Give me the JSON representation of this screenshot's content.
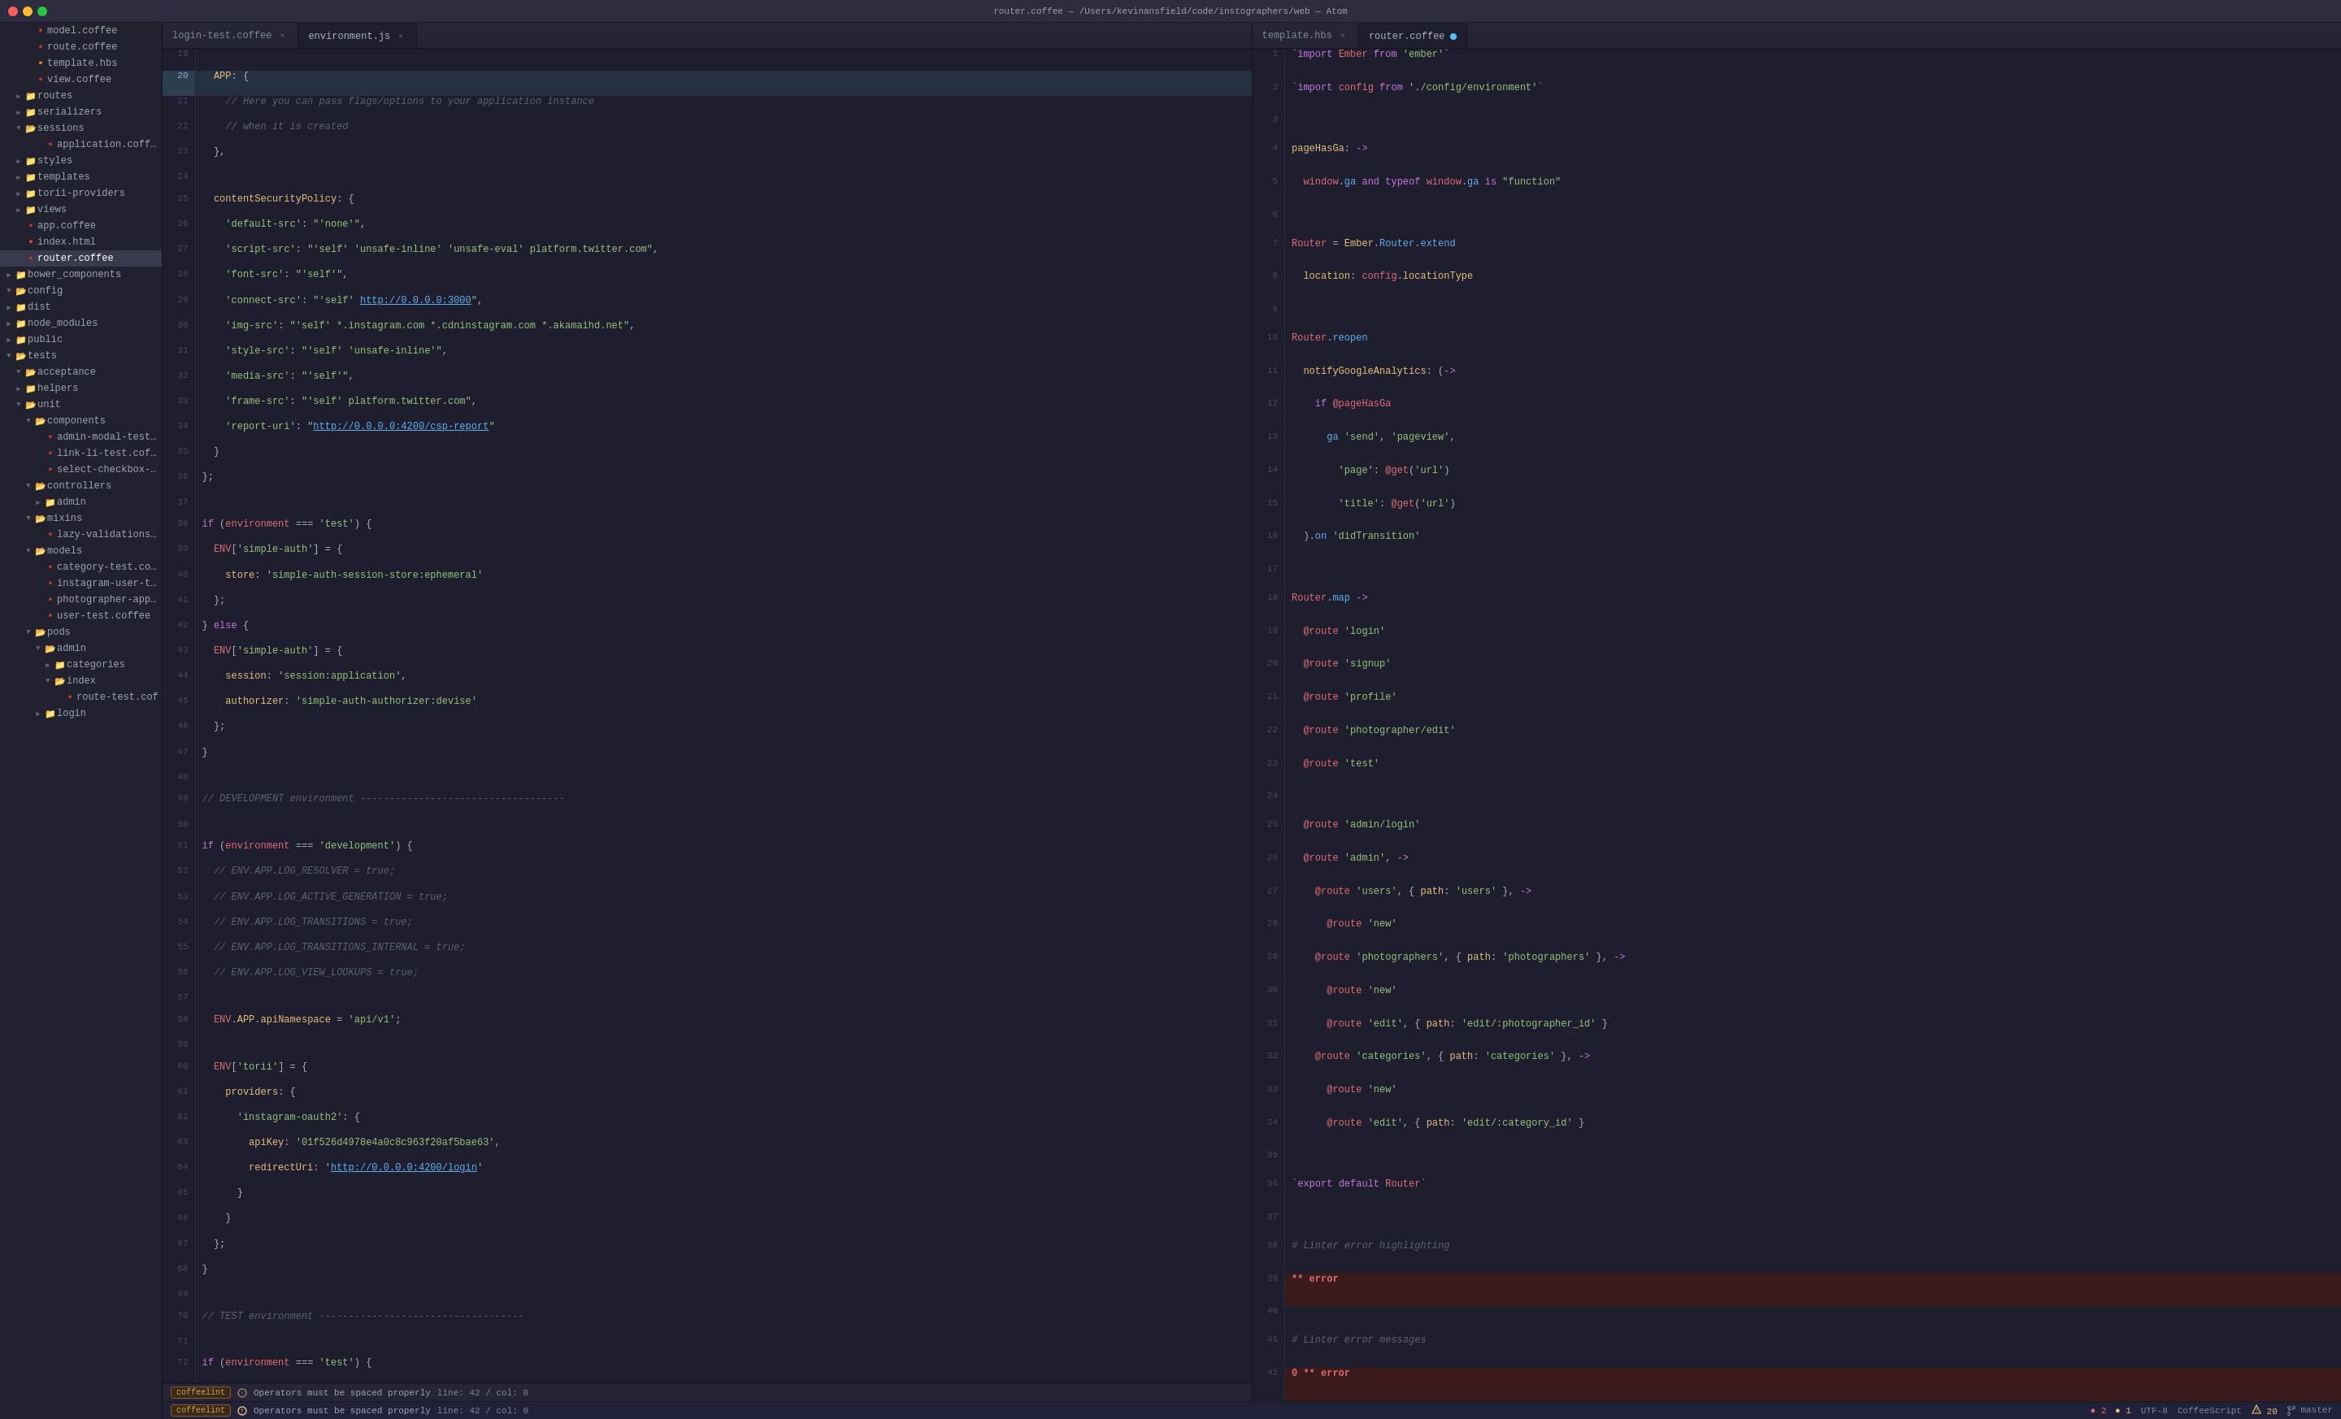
{
  "titlebar": {
    "title": "router.coffee — /Users/kevinansfield/code/instographers/web — Atom"
  },
  "sidebar": {
    "items": [
      {
        "id": "model-coffee",
        "label": "model.coffee",
        "type": "file-coffee",
        "indent": 2
      },
      {
        "id": "route-coffee",
        "label": "route.coffee",
        "type": "file-coffee",
        "indent": 2
      },
      {
        "id": "template-hbs",
        "label": "template.hbs",
        "type": "file-hbs",
        "indent": 2
      },
      {
        "id": "view-coffee",
        "label": "view.coffee",
        "type": "file-coffee",
        "indent": 2
      },
      {
        "id": "routes-folder",
        "label": "routes",
        "type": "folder",
        "indent": 1,
        "open": false
      },
      {
        "id": "serializers-folder",
        "label": "serializers",
        "type": "folder",
        "indent": 1,
        "open": false
      },
      {
        "id": "sessions-folder",
        "label": "sessions",
        "type": "folder",
        "indent": 1,
        "open": true
      },
      {
        "id": "application-coffee",
        "label": "application.coffee",
        "type": "file-coffee",
        "indent": 3
      },
      {
        "id": "styles-folder",
        "label": "styles",
        "type": "folder",
        "indent": 1,
        "open": false
      },
      {
        "id": "templates-folder",
        "label": "templates",
        "type": "folder",
        "indent": 1,
        "open": false
      },
      {
        "id": "torii-providers-folder",
        "label": "torii-providers",
        "type": "folder",
        "indent": 1,
        "open": false
      },
      {
        "id": "views-folder",
        "label": "views",
        "type": "folder",
        "indent": 1,
        "open": false
      },
      {
        "id": "app-coffee",
        "label": "app.coffee",
        "type": "file-coffee",
        "indent": 1
      },
      {
        "id": "index-html",
        "label": "index.html",
        "type": "file-html",
        "indent": 1
      },
      {
        "id": "router-coffee",
        "label": "router.coffee",
        "type": "file-coffee",
        "indent": 1,
        "active": true
      },
      {
        "id": "bower-components",
        "label": "bower_components",
        "type": "folder",
        "indent": 0,
        "open": false
      },
      {
        "id": "config-folder",
        "label": "config",
        "type": "folder",
        "indent": 0,
        "open": true
      },
      {
        "id": "dist-folder",
        "label": "dist",
        "type": "folder",
        "indent": 0,
        "open": false
      },
      {
        "id": "node-modules",
        "label": "node_modules",
        "type": "folder",
        "indent": 0,
        "open": false
      },
      {
        "id": "public-folder",
        "label": "public",
        "type": "folder",
        "indent": 0,
        "open": false
      },
      {
        "id": "tests-folder",
        "label": "tests",
        "type": "folder-yellow",
        "indent": 0,
        "open": true
      },
      {
        "id": "acceptance-folder",
        "label": "acceptance",
        "type": "folder-yellow",
        "indent": 1,
        "open": true
      },
      {
        "id": "helpers-folder",
        "label": "helpers",
        "type": "folder",
        "indent": 1,
        "open": false
      },
      {
        "id": "unit-folder",
        "label": "unit",
        "type": "folder",
        "indent": 1,
        "open": true
      },
      {
        "id": "components-folder",
        "label": "components",
        "type": "folder",
        "indent": 2,
        "open": true
      },
      {
        "id": "admin-modal-test",
        "label": "admin-modal-test.c",
        "type": "file-coffee",
        "indent": 3
      },
      {
        "id": "link-li-test",
        "label": "link-li-test.coffee",
        "type": "file-coffee",
        "indent": 3
      },
      {
        "id": "select-checkbox-test",
        "label": "select-checkbox-tes",
        "type": "file-coffee",
        "indent": 3
      },
      {
        "id": "controllers-folder",
        "label": "controllers",
        "type": "folder",
        "indent": 2,
        "open": true
      },
      {
        "id": "admin-folder",
        "label": "admin",
        "type": "folder",
        "indent": 3,
        "open": false
      },
      {
        "id": "mixins-folder",
        "label": "mixins",
        "type": "folder",
        "indent": 2,
        "open": true
      },
      {
        "id": "lazy-validations-test",
        "label": "lazy-validations-tes",
        "type": "file-coffee",
        "indent": 3
      },
      {
        "id": "models-folder",
        "label": "models",
        "type": "folder",
        "indent": 2,
        "open": true
      },
      {
        "id": "category-test-coffee",
        "label": "category-test.coffee",
        "type": "file-coffee",
        "indent": 3
      },
      {
        "id": "instagram-user-test",
        "label": "instagram-user-test.",
        "type": "file-coffee",
        "indent": 3
      },
      {
        "id": "photographer-appr",
        "label": "photographer-appro",
        "type": "file-coffee",
        "indent": 3
      },
      {
        "id": "user-test-coffee",
        "label": "user-test.coffee",
        "type": "file-coffee",
        "indent": 3
      },
      {
        "id": "pods-folder",
        "label": "pods",
        "type": "folder",
        "indent": 2,
        "open": true
      },
      {
        "id": "admin-subfolder",
        "label": "admin",
        "type": "folder",
        "indent": 3,
        "open": true
      },
      {
        "id": "categories-folder",
        "label": "categories",
        "type": "folder",
        "indent": 4,
        "open": false
      },
      {
        "id": "index-folder",
        "label": "index",
        "type": "folder",
        "indent": 4,
        "open": true
      },
      {
        "id": "route-test-cof",
        "label": "route-test.cof",
        "type": "file-coffee",
        "indent": 5
      },
      {
        "id": "login-folder",
        "label": "login",
        "type": "folder",
        "indent": 3,
        "open": false
      }
    ]
  },
  "tabs": {
    "left_panel": [
      {
        "id": "login-test",
        "label": "login-test.coffee",
        "active": false,
        "modified": false
      },
      {
        "id": "environment-js",
        "label": "environment.js",
        "active": true,
        "modified": false
      }
    ],
    "right_panel": [
      {
        "id": "template-hbs",
        "label": "template.hbs",
        "active": false,
        "modified": false
      },
      {
        "id": "router-coffee",
        "label": "router.coffee",
        "active": true,
        "modified": true,
        "dot_color": "#4fc3f7"
      }
    ]
  },
  "left_editor": {
    "filename": "environment.js",
    "lines": [
      {
        "num": 19,
        "content": ""
      },
      {
        "num": 20,
        "content": "  APP: {",
        "highlight": true
      },
      {
        "num": 21,
        "content": "    // Here you can pass flags/options to your application instance",
        "type": "comment"
      },
      {
        "num": 22,
        "content": "    // when it is created",
        "type": "comment"
      },
      {
        "num": 23,
        "content": "  },"
      },
      {
        "num": 24,
        "content": ""
      },
      {
        "num": 25,
        "content": "  contentSecurityPolicy: {"
      },
      {
        "num": 26,
        "content": "    'default-src': \"'none'\","
      },
      {
        "num": 27,
        "content": "    'script-src': \"'self' 'unsafe-inline' 'unsafe-eval' platform.twitter.com\","
      },
      {
        "num": 28,
        "content": "    'font-src': \"'self'\","
      },
      {
        "num": 29,
        "content": "    'connect-src': \"'self' http://0.0.0.0:3000\","
      },
      {
        "num": 30,
        "content": "    'img-src': \"'self' *.instagram.com *.cdninstagram.com *.akamaihd.net\","
      },
      {
        "num": 31,
        "content": "    'style-src': \"'self' 'unsafe-inline'\","
      },
      {
        "num": 32,
        "content": "    'media-src': \"'self'\","
      },
      {
        "num": 33,
        "content": "    'frame-src': \"'self' platform.twitter.com\","
      },
      {
        "num": 34,
        "content": "    'report-uri': \"http://0.0.0.0:4200/csp-report\""
      },
      {
        "num": 35,
        "content": "  }"
      },
      {
        "num": 36,
        "content": "};"
      },
      {
        "num": 37,
        "content": ""
      },
      {
        "num": 38,
        "content": "if (environment === 'test') {"
      },
      {
        "num": 39,
        "content": "  ENV['simple-auth'] = {"
      },
      {
        "num": 40,
        "content": "    store: 'simple-auth-session-store:ephemeral'"
      },
      {
        "num": 41,
        "content": "  };"
      },
      {
        "num": 42,
        "content": "} else {"
      },
      {
        "num": 43,
        "content": "  ENV['simple-auth'] = {"
      },
      {
        "num": 44,
        "content": "    session: 'session:application',"
      },
      {
        "num": 45,
        "content": "    authorizer: 'simple-auth-authorizer:devise'"
      },
      {
        "num": 46,
        "content": "  };"
      },
      {
        "num": 47,
        "content": "}"
      },
      {
        "num": 48,
        "content": ""
      },
      {
        "num": 49,
        "content": "// DEVELOPMENT environment -----------------------------------",
        "type": "comment"
      },
      {
        "num": 50,
        "content": ""
      },
      {
        "num": 51,
        "content": "if (environment === 'development') {"
      },
      {
        "num": 52,
        "content": "  // ENV.APP.LOG_RESOLVER = true;",
        "type": "comment"
      },
      {
        "num": 53,
        "content": "  // ENV.APP.LOG_ACTIVE_GENERATION = true;",
        "type": "comment"
      },
      {
        "num": 54,
        "content": "  // ENV.APP.LOG_TRANSITIONS = true;",
        "type": "comment"
      },
      {
        "num": 55,
        "content": "  // ENV.APP.LOG_TRANSITIONS_INTERNAL = true;",
        "type": "comment"
      },
      {
        "num": 56,
        "content": "  // ENV.APP.LOG_VIEW_LOOKUPS = true;",
        "type": "comment"
      },
      {
        "num": 57,
        "content": ""
      },
      {
        "num": 58,
        "content": "  ENV.APP.apiNamespace = 'api/v1';"
      },
      {
        "num": 59,
        "content": ""
      },
      {
        "num": 60,
        "content": "  ENV['torii'] = {"
      },
      {
        "num": 61,
        "content": "    providers: {"
      },
      {
        "num": 62,
        "content": "      'instagram-oauth2': {"
      },
      {
        "num": 63,
        "content": "        apiKey: '01f526d4978e4a0c8c963f20af5bae63',"
      },
      {
        "num": 64,
        "content": "        redirectUri: 'http://0.0.0.0:4200/login'"
      },
      {
        "num": 65,
        "content": "      }"
      },
      {
        "num": 66,
        "content": "    }"
      },
      {
        "num": 67,
        "content": "  };"
      },
      {
        "num": 68,
        "content": "}"
      },
      {
        "num": 69,
        "content": ""
      },
      {
        "num": 70,
        "content": "// TEST environment -----------------------------------",
        "type": "comment"
      },
      {
        "num": 71,
        "content": ""
      },
      {
        "num": 72,
        "content": "if (environment === 'test') {"
      }
    ]
  },
  "right_editor": {
    "filename": "router.coffee",
    "lines": [
      {
        "num": 1,
        "content": "`import Ember from 'ember'`"
      },
      {
        "num": 2,
        "content": "`import config from './config/environment'`"
      },
      {
        "num": 3,
        "content": ""
      },
      {
        "num": 4,
        "content": "pageHasGa: ->"
      },
      {
        "num": 5,
        "content": "  window.ga and typeof window.ga is \"function\""
      },
      {
        "num": 6,
        "content": ""
      },
      {
        "num": 7,
        "content": "Router = Ember.Router.extend"
      },
      {
        "num": 8,
        "content": "  location: config.locationType"
      },
      {
        "num": 9,
        "content": ""
      },
      {
        "num": 10,
        "content": "Router.reopen"
      },
      {
        "num": 11,
        "content": "  notifyGoogleAnalytics: (->"
      },
      {
        "num": 12,
        "content": "    if @pageHasGa"
      },
      {
        "num": 13,
        "content": "      ga 'send', 'pageview',"
      },
      {
        "num": 14,
        "content": "        'page': @get('url')"
      },
      {
        "num": 15,
        "content": "        'title': @get('url')"
      },
      {
        "num": 16,
        "content": "  ).on 'didTransition'"
      },
      {
        "num": 17,
        "content": ""
      },
      {
        "num": 18,
        "content": "Router.map ->"
      },
      {
        "num": 19,
        "content": "  @route 'login'"
      },
      {
        "num": 20,
        "content": "  @route 'signup'"
      },
      {
        "num": 21,
        "content": "  @route 'profile'"
      },
      {
        "num": 22,
        "content": "  @route 'photographer/edit'"
      },
      {
        "num": 23,
        "content": "  @route 'test'"
      },
      {
        "num": 24,
        "content": ""
      },
      {
        "num": 25,
        "content": "  @route 'admin/login'"
      },
      {
        "num": 26,
        "content": "  @route 'admin', ->"
      },
      {
        "num": 27,
        "content": "    @route 'users', { path: 'users' }, ->"
      },
      {
        "num": 28,
        "content": "      @route 'new'"
      },
      {
        "num": 29,
        "content": "    @route 'photographers', { path: 'photographers' }, ->"
      },
      {
        "num": 30,
        "content": "      @route 'new'"
      },
      {
        "num": 31,
        "content": "      @route 'edit', { path: 'edit/:photographer_id' }"
      },
      {
        "num": 32,
        "content": "    @route 'categories', { path: 'categories' }, ->"
      },
      {
        "num": 33,
        "content": "      @route 'new'"
      },
      {
        "num": 34,
        "content": "      @route 'edit', { path: 'edit/:category_id' }"
      },
      {
        "num": 35,
        "content": ""
      },
      {
        "num": 36,
        "content": "`export default Router`"
      },
      {
        "num": 37,
        "content": ""
      },
      {
        "num": 38,
        "content": "# Linter error highlighting",
        "type": "comment"
      },
      {
        "num": 39,
        "content": "** error",
        "type": "linterr"
      },
      {
        "num": 40,
        "content": ""
      },
      {
        "num": 41,
        "content": "# Linter error messages",
        "type": "comment"
      },
      {
        "num": 42,
        "content": "0 ** error",
        "type": "linterr"
      }
    ]
  },
  "statusbar": {
    "coffeelint_label": "coffeelint",
    "lint_message": "Operators must be spaced properly",
    "position": "line: 42 / col: 0",
    "errors": "2",
    "warnings": "1",
    "encoding": "UTF-8",
    "syntax": "CoffeeScript",
    "coffee_warnings": "20",
    "branch": "master"
  }
}
